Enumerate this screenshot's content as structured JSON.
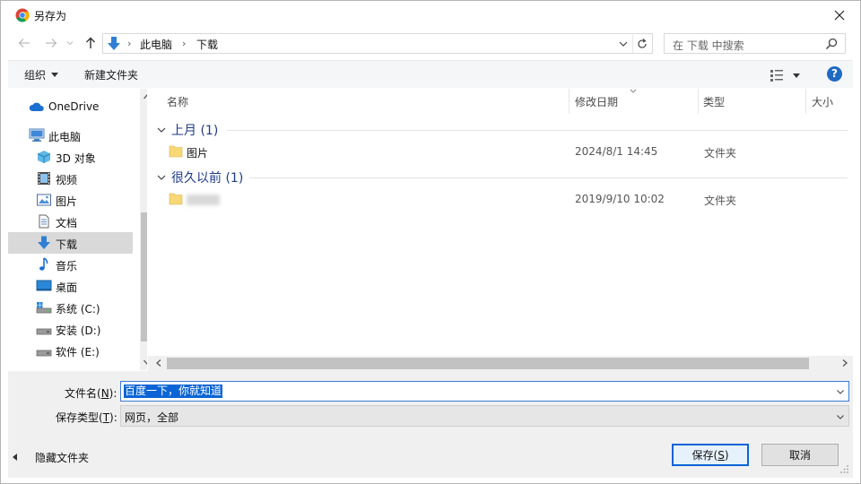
{
  "window": {
    "title": "另存为",
    "close_glyph": "✕"
  },
  "nav": {
    "back_glyph": "←",
    "forward_glyph": "→",
    "up_glyph": "↑",
    "breadcrumb": [
      "此电脑",
      "下载"
    ],
    "crumb_sep": "›",
    "search_placeholder": "在 下载 中搜索"
  },
  "toolbar": {
    "organize_label": "组织",
    "new_folder_label": "新建文件夹",
    "help_label": "?"
  },
  "sidebar": {
    "items": [
      {
        "label": "OneDrive",
        "icon": "cloud-icon"
      },
      {
        "label": "此电脑",
        "icon": "computer-icon"
      },
      {
        "label": "3D 对象",
        "icon": "cube-icon"
      },
      {
        "label": "视频",
        "icon": "film-icon"
      },
      {
        "label": "图片",
        "icon": "picture-icon"
      },
      {
        "label": "文档",
        "icon": "document-icon"
      },
      {
        "label": "下载",
        "icon": "download-arrow-icon",
        "selected": true
      },
      {
        "label": "音乐",
        "icon": "music-note-icon"
      },
      {
        "label": "桌面",
        "icon": "desktop-icon"
      },
      {
        "label": "系统 (C:)",
        "icon": "drive-icon"
      },
      {
        "label": "安装 (D:)",
        "icon": "drive-icon"
      },
      {
        "label": "软件 (E:)",
        "icon": "drive-icon"
      }
    ]
  },
  "filelist": {
    "columns": {
      "name": "名称",
      "date": "修改日期",
      "type": "类型",
      "size": "大小"
    },
    "groups": [
      {
        "label": "上月 (1)",
        "rows": [
          {
            "name": "图片",
            "date": "2024/8/1 14:45",
            "type": "文件夹"
          }
        ]
      },
      {
        "label": "很久以前 (1)",
        "rows": [
          {
            "name": "",
            "date": "2019/9/10 10:02",
            "type": "文件夹",
            "blurred": true
          }
        ]
      }
    ]
  },
  "form": {
    "filename_label": "文件名(",
    "filename_key": "N",
    "filename_label_end": "):",
    "filename_value": "百度一下，你就知道",
    "filetype_label": "保存类型(",
    "filetype_key": "T",
    "filetype_label_end": "):",
    "filetype_value": "网页，全部",
    "hide_folders_label": "隐藏文件夹",
    "save_label": "保存(",
    "save_key": "S",
    "save_label_end": ")",
    "cancel_label": "取消"
  },
  "colors": {
    "accent": "#0a64d6",
    "group_heading": "#1e3a8a",
    "folder": "#f8d775",
    "selection_bg": "#d9d9d9"
  }
}
